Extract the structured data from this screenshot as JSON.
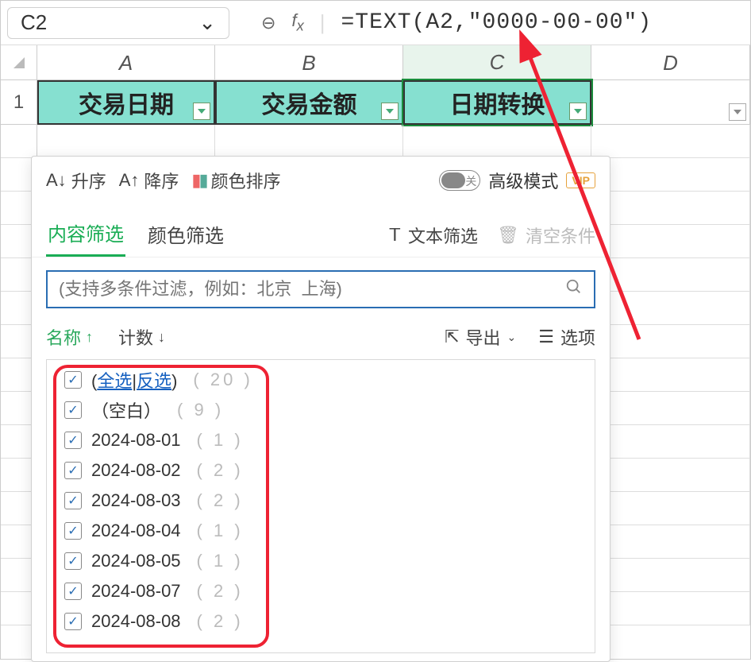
{
  "name_box": "C2",
  "formula": "=TEXT(A2,\"0000-00-00\")",
  "columns": [
    "A",
    "B",
    "C",
    "D"
  ],
  "row1_label": "1",
  "headers": {
    "A": "交易日期",
    "B": "交易金额",
    "C": "日期转换"
  },
  "dropdown": {
    "sort_asc": "升序",
    "sort_desc": "降序",
    "color_sort": "颜色排序",
    "switch_off": "关",
    "advanced": "高级模式",
    "vip": "VIP",
    "tab_content": "内容筛选",
    "tab_color": "颜色筛选",
    "text_filter": "文本筛选",
    "clear": "清空条件",
    "search_placeholder": "(支持多条件过滤，例如：北京  上海)",
    "lh_name": "名称",
    "lh_count": "计数",
    "export": "导出",
    "options": "选项",
    "select_all": "全选",
    "invert": "反选",
    "select_count": "20",
    "blank": "（空白）",
    "blank_count": "9",
    "items": [
      {
        "v": "2024-08-01",
        "c": "1"
      },
      {
        "v": "2024-08-02",
        "c": "2"
      },
      {
        "v": "2024-08-03",
        "c": "2"
      },
      {
        "v": "2024-08-04",
        "c": "1"
      },
      {
        "v": "2024-08-05",
        "c": "1"
      },
      {
        "v": "2024-08-07",
        "c": "2"
      },
      {
        "v": "2024-08-08",
        "c": "2"
      }
    ]
  }
}
